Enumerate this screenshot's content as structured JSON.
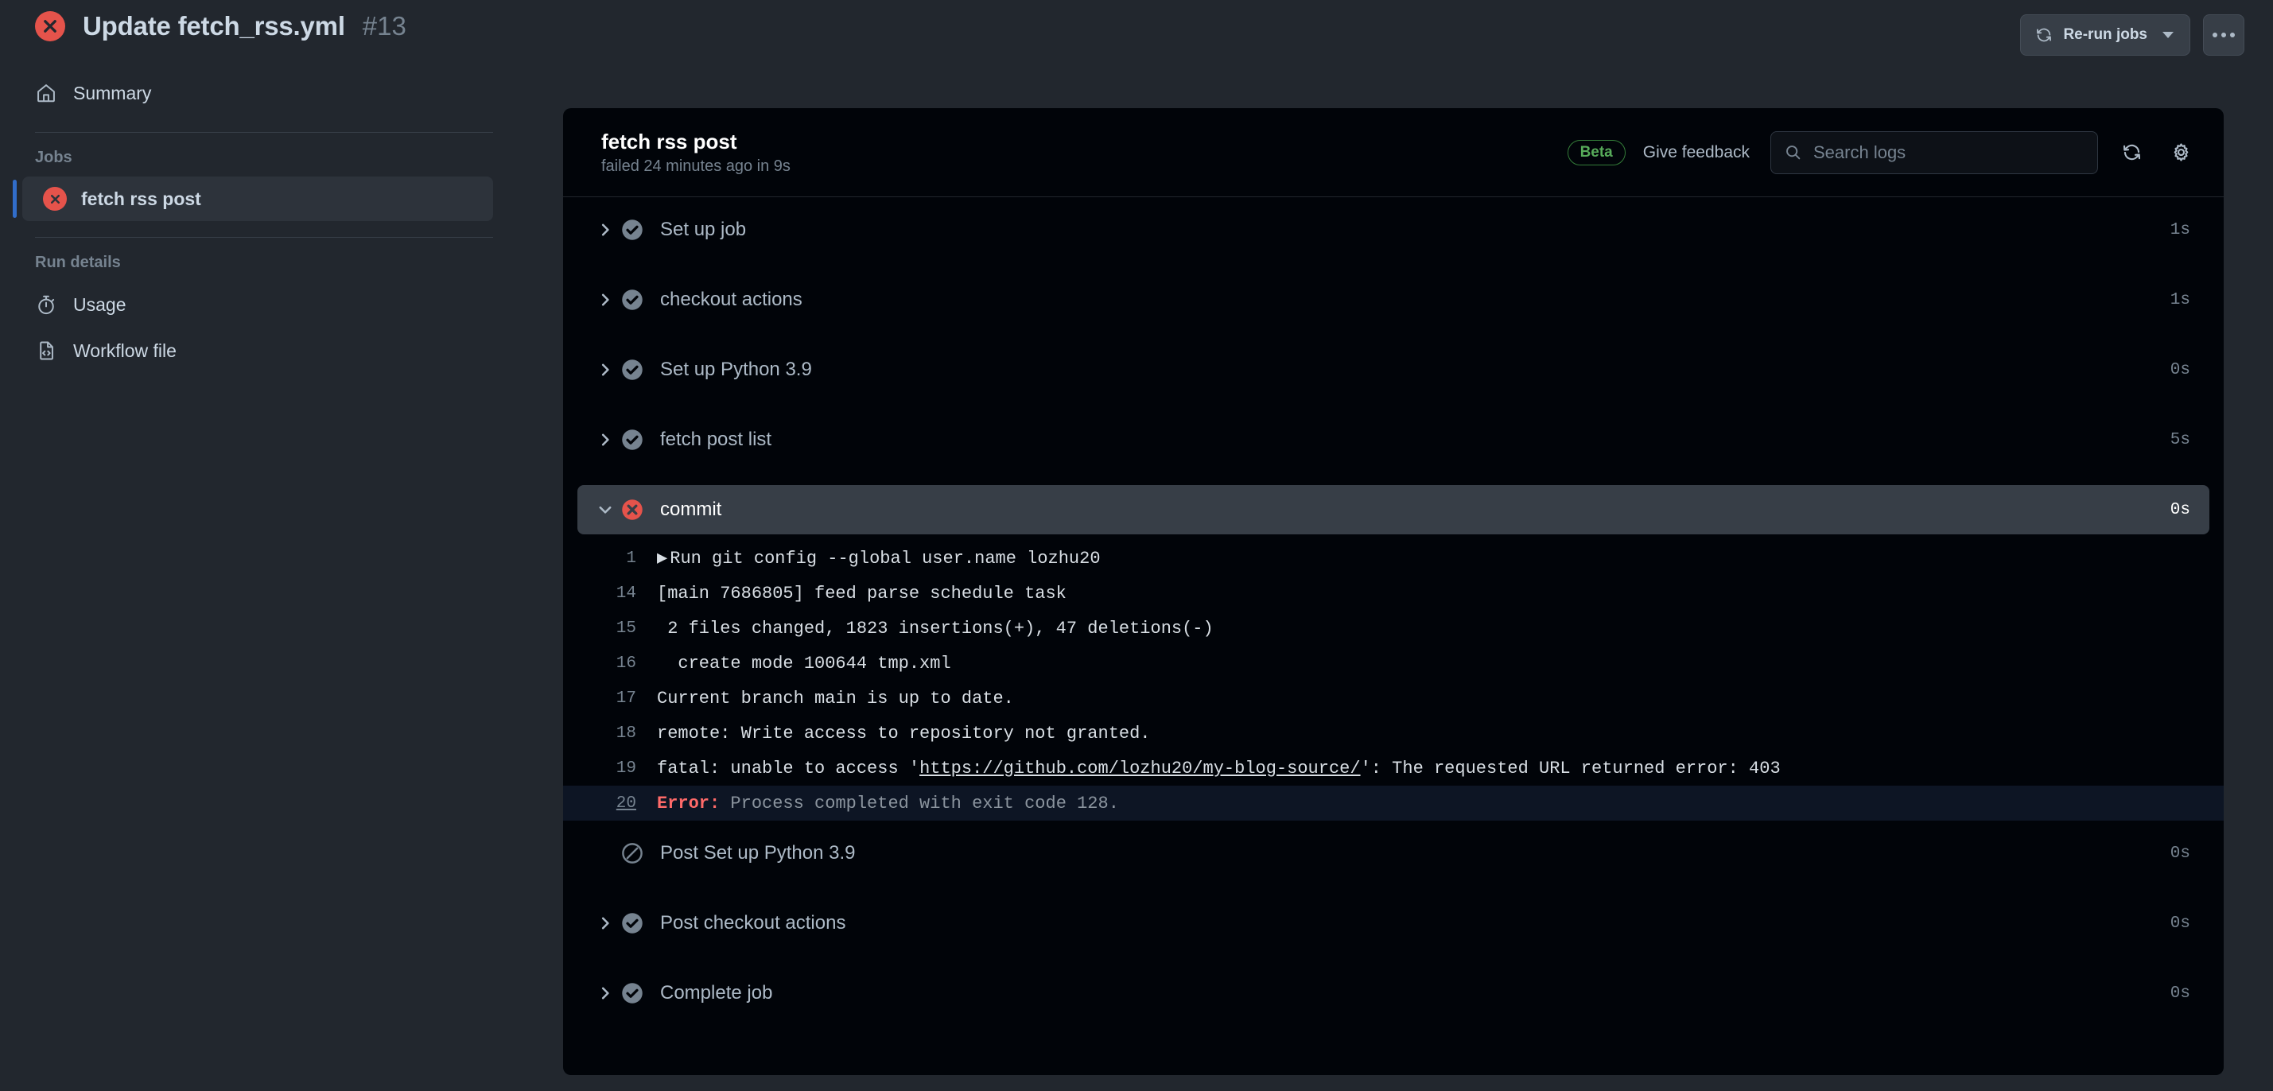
{
  "topbar": {
    "title": "Update fetch_rss.yml",
    "run_number": "#13",
    "status_icon": "x-circle-fail-icon",
    "rerun_label": "Re-run jobs",
    "rerun_icon": "sync-icon",
    "kebab_icon": "kebab-horizontal-icon"
  },
  "sidebar": {
    "summary": {
      "label": "Summary",
      "icon": "home-icon"
    },
    "jobs_heading": "Jobs",
    "jobs": [
      {
        "label": "fetch rss post",
        "status": "failed",
        "icon": "x-circle-fail-icon"
      }
    ],
    "run_details_heading": "Run details",
    "run_details": [
      {
        "label": "Usage",
        "icon": "stopwatch-icon"
      },
      {
        "label": "Workflow file",
        "icon": "file-code-icon"
      }
    ]
  },
  "log_header": {
    "title": "fetch rss post",
    "subtitle": "failed 24 minutes ago in 9s",
    "beta_badge": "Beta",
    "feedback_label": "Give feedback",
    "search_placeholder": "Search logs",
    "search_value": "",
    "search_icon": "search-icon",
    "refresh_icon": "sync-icon",
    "settings_icon": "gear-icon"
  },
  "steps": [
    {
      "label": "Set up job",
      "time": "1s",
      "status": "success",
      "icon": "check-circle-icon",
      "expandable": true,
      "expanded": false
    },
    {
      "label": "checkout actions",
      "time": "1s",
      "status": "success",
      "icon": "check-circle-icon",
      "expandable": true,
      "expanded": false
    },
    {
      "label": "Set up Python 3.9",
      "time": "0s",
      "status": "success",
      "icon": "check-circle-icon",
      "expandable": true,
      "expanded": false
    },
    {
      "label": "fetch post list",
      "time": "5s",
      "status": "success",
      "icon": "check-circle-icon",
      "expandable": true,
      "expanded": false
    },
    {
      "label": "commit",
      "time": "0s",
      "status": "failure",
      "icon": "x-circle-fail-icon",
      "expandable": true,
      "expanded": true
    },
    {
      "label": "Post Set up Python 3.9",
      "time": "0s",
      "status": "skipped",
      "icon": "skip-circle-icon",
      "expandable": false,
      "expanded": false
    },
    {
      "label": "Post checkout actions",
      "time": "0s",
      "status": "success",
      "icon": "check-circle-icon",
      "expandable": true,
      "expanded": false
    },
    {
      "label": "Complete job",
      "time": "0s",
      "status": "success",
      "icon": "check-circle-icon",
      "expandable": true,
      "expanded": false
    }
  ],
  "log_lines": [
    {
      "number": "1",
      "prefix_icon": "collapse-triangle-icon",
      "text": "Run git config --global user.name lozhu20",
      "type": "command"
    },
    {
      "number": "14",
      "text": "[main 7686805] feed parse schedule task",
      "type": "plain"
    },
    {
      "number": "15",
      "text": " 2 files changed, 1823 insertions(+), 47 deletions(-)",
      "type": "plain"
    },
    {
      "number": "16",
      "text": "  create mode 100644 tmp.xml",
      "type": "plain"
    },
    {
      "number": "17",
      "text": "Current branch main is up to date.",
      "type": "plain"
    },
    {
      "number": "18",
      "text": "remote: Write access to repository not granted.",
      "type": "plain"
    },
    {
      "number": "19",
      "type": "link",
      "text_before": "fatal: unable to access '",
      "link_text": "https://github.com/lozhu20/my-blog-source/",
      "text_after": "': The requested URL returned error: 403"
    },
    {
      "number": "20",
      "type": "error",
      "error_tag": "Error:",
      "error_message": " Process completed with exit code 128."
    }
  ],
  "colors": {
    "page_bg": "#22272e",
    "panel_bg": "#010409",
    "accent_blue": "#316dca",
    "fail_red": "#e5534b",
    "error_red": "#ff6a69",
    "beta_green": "#57ab5a",
    "active_row": "#373e47",
    "error_row": "#0d1524"
  }
}
